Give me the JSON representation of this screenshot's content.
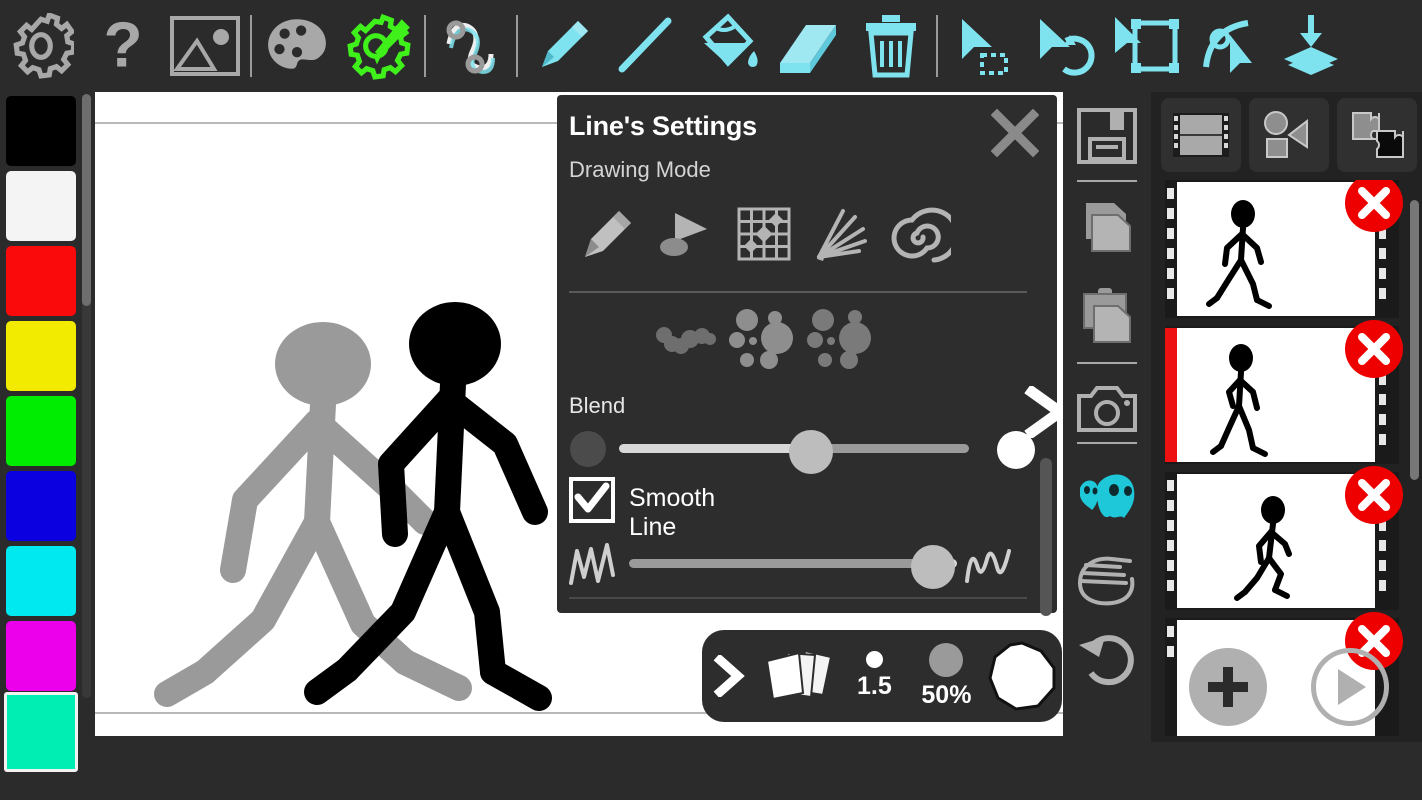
{
  "app": {
    "title": "Stick Figure Animation Editor",
    "background_color": "#2b2b2b",
    "accent_cyan": "#7fe3ef",
    "accent_green": "#3ff01b"
  },
  "top_toolbar": {
    "items": [
      {
        "name": "settings-gear-icon",
        "label": "Settings",
        "color": "#a8a8a8"
      },
      {
        "name": "help-question-icon",
        "label": "Help",
        "color": "#a8a8a8"
      },
      {
        "name": "image-icon",
        "label": "Image",
        "color": "#a8a8a8"
      },
      {
        "name": "divider",
        "label": "",
        "color": "#9a9a9a"
      },
      {
        "name": "palette-icon",
        "label": "Color Palette",
        "color": "#a8a8a8"
      },
      {
        "name": "brush-settings-gear-icon",
        "label": "Brush Settings",
        "color": "#3ff01b"
      },
      {
        "name": "divider",
        "label": "",
        "color": "#9a9a9a"
      },
      {
        "name": "path-node-icon",
        "label": "Node Path",
        "color": "#cfcfcf"
      },
      {
        "name": "divider",
        "label": "",
        "color": "#9a9a9a"
      },
      {
        "name": "pencil-icon",
        "label": "Pencil",
        "color": "#7fe3ef"
      },
      {
        "name": "line-icon",
        "label": "Line",
        "color": "#7fe3ef"
      },
      {
        "name": "fill-bucket-icon",
        "label": "Fill",
        "color": "#7fe3ef"
      },
      {
        "name": "eraser-icon",
        "label": "Eraser",
        "color": "#7fe3ef"
      },
      {
        "name": "trash-icon",
        "label": "Delete",
        "color": "#7fe3ef"
      },
      {
        "name": "divider",
        "label": "",
        "color": "#9a9a9a"
      },
      {
        "name": "select-cursor-icon",
        "label": "Select",
        "color": "#7fe3ef"
      },
      {
        "name": "undo-cursor-icon",
        "label": "Undo Select",
        "color": "#7fe3ef"
      },
      {
        "name": "transform-frame-icon",
        "label": "Transform",
        "color": "#7fe3ef"
      },
      {
        "name": "node-edit-icon",
        "label": "Edit Node",
        "color": "#7fe3ef"
      },
      {
        "name": "layers-down-icon",
        "label": "Merge Layers",
        "color": "#7fe3ef"
      }
    ]
  },
  "palette": {
    "label": "Color Palette",
    "selected_index": 8,
    "swatches": [
      {
        "name": "swatch-black",
        "color": "#000000"
      },
      {
        "name": "swatch-white",
        "color": "#f4f4f4"
      },
      {
        "name": "swatch-red",
        "color": "#fa0a0a"
      },
      {
        "name": "swatch-yellow",
        "color": "#f2eb00"
      },
      {
        "name": "swatch-green",
        "color": "#00ec00"
      },
      {
        "name": "swatch-blue",
        "color": "#0a00e0"
      },
      {
        "name": "swatch-cyan",
        "color": "#00e8f0"
      },
      {
        "name": "swatch-magenta",
        "color": "#ec00ec"
      },
      {
        "name": "swatch-spring-green",
        "color": "#00eeb4"
      }
    ]
  },
  "canvas": {
    "label": "Drawing Canvas",
    "background": "#ffffff",
    "onion_skin_color": "#9a9a9a",
    "figure_color": "#000000",
    "figures": [
      {
        "name": "onion-skin-figure",
        "pose": "walking",
        "color": "#9a9a9a"
      },
      {
        "name": "active-figure",
        "pose": "walking",
        "color": "#000000"
      }
    ]
  },
  "settings_panel": {
    "title": "Line's Settings",
    "close_label": "✕",
    "section_label": "Drawing Mode",
    "drawing_modes": [
      {
        "name": "pencil-mode-icon",
        "label": "Pencil"
      },
      {
        "name": "calligraphy-mode-icon",
        "label": "Calligraphy"
      },
      {
        "name": "pattern-grid-mode-icon",
        "label": "Pattern"
      },
      {
        "name": "fan-bristle-mode-icon",
        "label": "Bristle"
      },
      {
        "name": "spiral-mode-icon",
        "label": "Spiral"
      }
    ],
    "texture_modes": [
      {
        "name": "scatter-small-icon",
        "label": "Scatter Small"
      },
      {
        "name": "scatter-medium-icon",
        "label": "Scatter Medium"
      },
      {
        "name": "scatter-large-icon",
        "label": "Scatter Large"
      }
    ],
    "blend": {
      "label": "Blend",
      "value_percent": 46,
      "min_icon": "dark-circle-icon",
      "max_icon": "light-circle-icon"
    },
    "smooth_line": {
      "label": "Smooth Line",
      "checked": true,
      "check_glyph": "✓",
      "value_percent": 88,
      "min_icon": "jagged-line-icon",
      "max_icon": "smooth-wave-icon"
    },
    "next_arrow": "next-page-arrow-icon"
  },
  "brush_bar": {
    "expand_arrow": "expand-arrow-icon",
    "layers_icon": "brush-stack-icon",
    "size_label": "1.5",
    "opacity_label": "50%",
    "color_preview_name": "current-color-preview",
    "color_preview_color": "#ffffff"
  },
  "right_tools": {
    "items": [
      {
        "name": "save-icon",
        "label": "Save"
      },
      {
        "name": "divider",
        "label": ""
      },
      {
        "name": "copy-icon",
        "label": "Copy"
      },
      {
        "name": "paste-icon",
        "label": "Paste"
      },
      {
        "name": "divider",
        "label": ""
      },
      {
        "name": "camera-icon",
        "label": "Snapshot"
      },
      {
        "name": "divider",
        "label": ""
      },
      {
        "name": "onion-skin-ghost-icon",
        "label": "Onion Skin",
        "active": true
      },
      {
        "name": "hand-pan-icon",
        "label": "Pan"
      },
      {
        "name": "undo-icon",
        "label": "Undo"
      }
    ]
  },
  "frames_panel": {
    "tabs": [
      {
        "name": "tab-frames",
        "label": "Frames",
        "icon": "film-strip-icon",
        "active": true
      },
      {
        "name": "tab-shapes",
        "label": "Shapes",
        "icon": "shapes-icon",
        "active": false
      },
      {
        "name": "tab-plugins",
        "label": "Plugins",
        "icon": "puzzle-icon",
        "active": false
      }
    ],
    "frames": [
      {
        "name": "frame-item",
        "index": 1,
        "selected": false,
        "pose": "walk-a",
        "delete_glyph": "✕"
      },
      {
        "name": "frame-item",
        "index": 2,
        "selected": true,
        "pose": "walk-b",
        "delete_glyph": "✕"
      },
      {
        "name": "frame-item",
        "index": 3,
        "selected": false,
        "pose": "walk-c",
        "delete_glyph": "✕"
      },
      {
        "name": "frame-item",
        "index": 4,
        "selected": false,
        "pose": "walk-d",
        "delete_glyph": "✕"
      }
    ],
    "add_button": {
      "name": "add-frame-button",
      "label": "+"
    },
    "play_button": {
      "name": "play-button",
      "label": "▶"
    }
  }
}
